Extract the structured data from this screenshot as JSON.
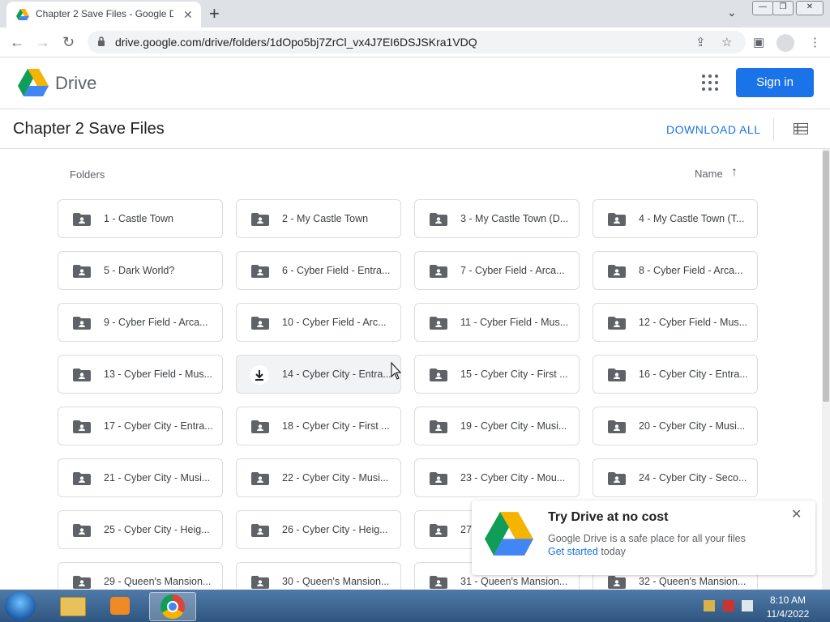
{
  "browser": {
    "tab_title": "Chapter 2 Save Files - Google Dr",
    "tab_close": "✕",
    "new_tab": "+",
    "url": "drive.google.com/drive/folders/1dOpo5bj7ZrCl_vx4J7EI6DSJSKra1VDQ"
  },
  "drive": {
    "logo_text": "Drive",
    "sign_in": "Sign in",
    "folder_title": "Chapter 2 Save Files",
    "download_all": "DOWNLOAD ALL",
    "folders_label": "Folders",
    "sort_label": "Name",
    "sort_arrow": "↑"
  },
  "folders": [
    "1 - Castle Town",
    "2 - My Castle Town",
    "3 - My Castle Town (D...",
    "4 - My Castle Town (T...",
    "5 - Dark World?",
    "6 - Cyber Field - Entra...",
    "7 - Cyber Field - Arca...",
    "8 - Cyber Field - Arca...",
    "9 - Cyber Field - Arca...",
    "10 - Cyber Field - Arc...",
    "11 - Cyber Field - Mus...",
    "12 - Cyber Field - Mus...",
    "13 - Cyber Field - Mus...",
    "14 - Cyber City - Entra...",
    "15 - Cyber City - First ...",
    "16 - Cyber City - Entra...",
    "17 - Cyber City - Entra...",
    "18 - Cyber City - First ...",
    "19 - Cyber City - Musi...",
    "20 - Cyber City - Musi...",
    "21 - Cyber City - Musi...",
    "22 - Cyber City - Musi...",
    "23 - Cyber City - Mou...",
    "24 - Cyber City - Seco...",
    "25 - Cyber City - Heig...",
    "26 - Cyber City - Heig...",
    "27",
    "",
    "29 - Queen's Mansion...",
    "30 - Queen's Mansion...",
    "31 - Queen's Mansion...",
    "32 - Queen's Mansion..."
  ],
  "promo": {
    "title": "Try Drive at no cost",
    "text": "Google Drive is a safe place for all your files",
    "link": "Get started",
    "tail": " today",
    "close": "✕"
  },
  "taskbar": {
    "time": "8:10 AM",
    "date": "11/4/2022"
  },
  "colors": {
    "accent": "#1a73e8",
    "drive_green": "#0f9d58",
    "drive_yellow": "#f4b400",
    "drive_blue": "#4285f4"
  }
}
